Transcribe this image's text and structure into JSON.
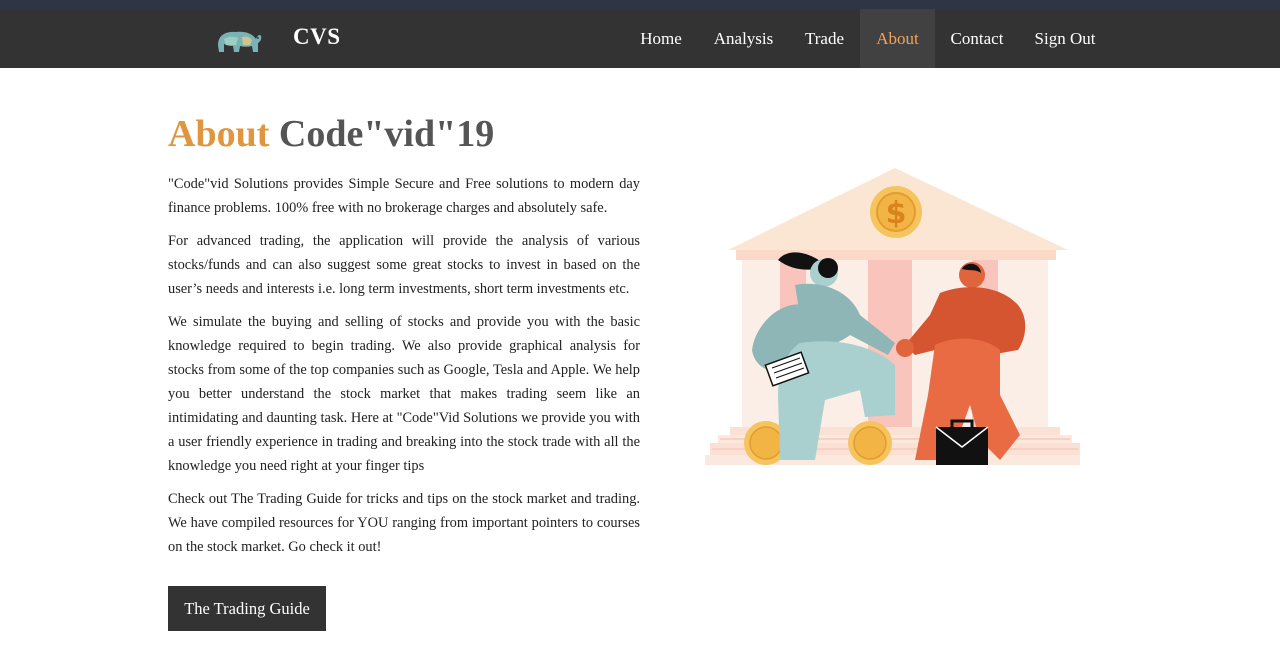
{
  "header": {
    "brand": "CVS",
    "logo_icon": "bear-icon",
    "nav": [
      {
        "label": "Home",
        "active": false
      },
      {
        "label": "Analysis",
        "active": false
      },
      {
        "label": "Trade",
        "active": false
      },
      {
        "label": "About",
        "active": true
      },
      {
        "label": "Contact",
        "active": false
      },
      {
        "label": "Sign Out",
        "active": false
      }
    ]
  },
  "main": {
    "title_accent": "About",
    "title_rest": "Code\"vid\"19",
    "paragraphs": [
      "\"Code\"vid Solutions provides Simple Secure and Free solutions to modern day finance problems. 100% free with no brokerage charges and absolutely safe.",
      "For advanced trading, the application will provide the analysis of various stocks/funds and can also suggest some great stocks to invest in based on the user’s needs and interests i.e. long term investments, short term investments etc.",
      "We simulate the buying and selling of stocks and provide you with the basic knowledge required to begin trading. We also provide graphical analysis for stocks from some of the top companies such as Google, Tesla and Apple. We help you better understand the stock market that makes trading seem like an intimidating and daunting task. Here at \"Code\"Vid Solutions we provide you with a user friendly experience in trading and breaking into the stock trade with all the knowledge you need right at your finger tips",
      "Check out The Trading Guide for tricks and tips on the stock market and trading. We have compiled resources for YOU ranging from important pointers to courses on the stock market. Go check it out!"
    ],
    "button_label": "The Trading Guide",
    "illustration_coin_symbol": "$"
  },
  "colors": {
    "navbar": "#333333",
    "active_nav_bg": "#414141",
    "active_nav_text": "#f4a259",
    "title_accent": "#e0953f",
    "button_bg": "#333333"
  }
}
